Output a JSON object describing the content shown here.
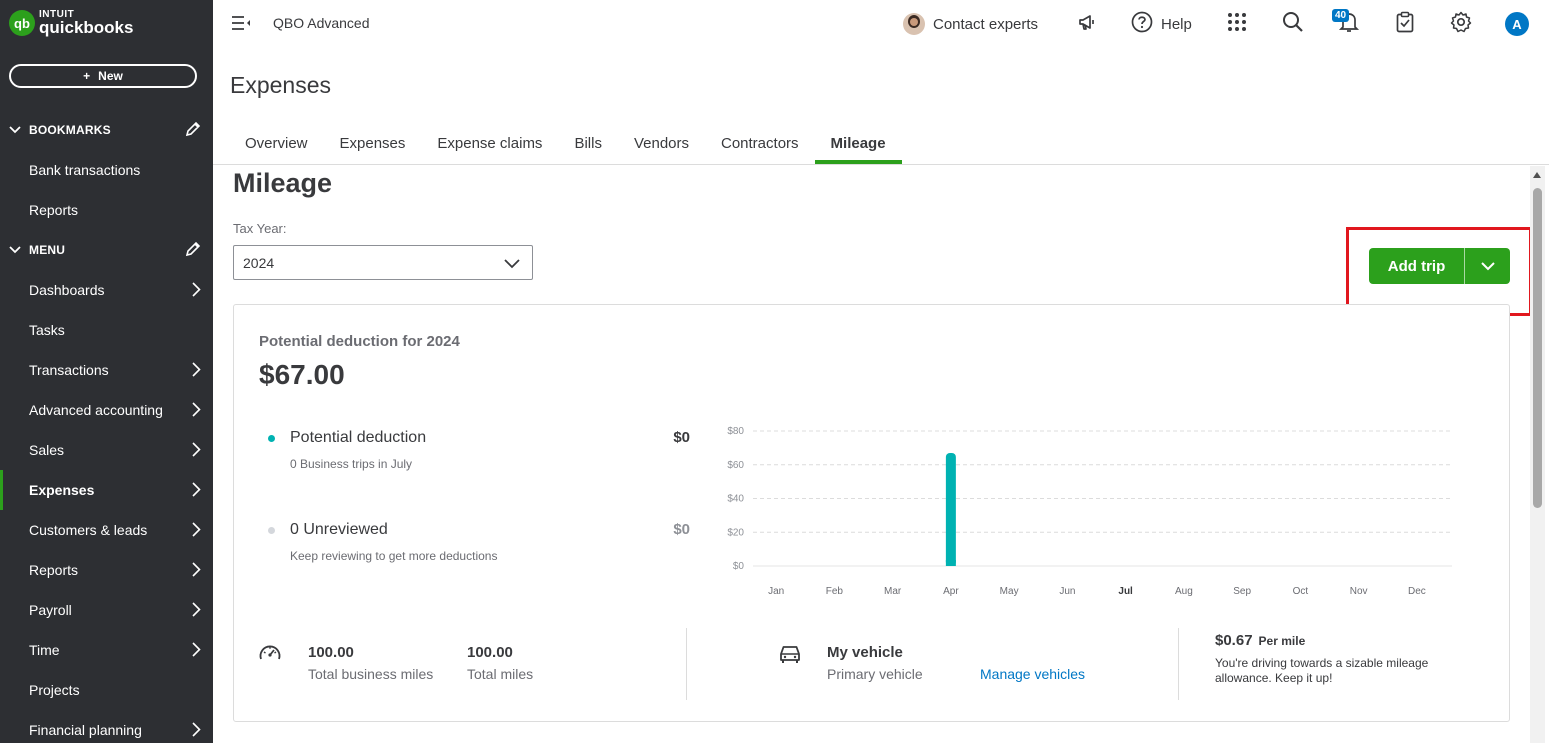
{
  "brand": {
    "logo_mark": "qb",
    "intuit": "INTUIT",
    "name": "quickbooks",
    "accent": "#2ca01c"
  },
  "sidebar": {
    "new_label": "New",
    "bookmarks_title": "BOOKMARKS",
    "bookmarks": [
      {
        "label": "Bank transactions"
      },
      {
        "label": "Reports"
      }
    ],
    "menu_title": "MENU",
    "menu": [
      {
        "label": "Dashboards",
        "has_arrow": true
      },
      {
        "label": "Tasks",
        "has_arrow": false
      },
      {
        "label": "Transactions",
        "has_arrow": true
      },
      {
        "label": "Advanced accounting",
        "has_arrow": true
      },
      {
        "label": "Sales",
        "has_arrow": true
      },
      {
        "label": "Expenses",
        "has_arrow": true,
        "active": true
      },
      {
        "label": "Customers & leads",
        "has_arrow": true
      },
      {
        "label": "Reports",
        "has_arrow": true
      },
      {
        "label": "Payroll",
        "has_arrow": true
      },
      {
        "label": "Time",
        "has_arrow": true
      },
      {
        "label": "Projects",
        "has_arrow": false
      },
      {
        "label": "Financial planning",
        "has_arrow": true
      }
    ]
  },
  "topbar": {
    "app_name": "QBO Advanced",
    "contact_experts": "Contact experts",
    "help": "Help",
    "notifications_count": "40",
    "user_initial": "A"
  },
  "header": {
    "title": "Expenses",
    "tabs": [
      {
        "label": "Overview"
      },
      {
        "label": "Expenses"
      },
      {
        "label": "Expense claims"
      },
      {
        "label": "Bills"
      },
      {
        "label": "Vendors"
      },
      {
        "label": "Contractors"
      },
      {
        "label": "Mileage",
        "active": true
      }
    ]
  },
  "mileage": {
    "title": "Mileage",
    "tax_year_label": "Tax Year:",
    "tax_year_value": "2024",
    "add_trip_label": "Add trip",
    "card": {
      "deduction_label": "Potential deduction for 2024",
      "deduction_amount": "$67.00",
      "legend": [
        {
          "label": "Potential deduction",
          "sub": "0 Business trips in July",
          "value": "$0",
          "dot_color": "#00b2b2"
        },
        {
          "label": "0 Unreviewed",
          "sub": "Keep reviewing to get more deductions",
          "value": "$0",
          "dot_color": "#d4d7dc"
        }
      ],
      "stats": {
        "total_business_miles": "100.00",
        "total_business_miles_label": "Total business miles",
        "total_miles": "100.00",
        "total_miles_label": "Total miles",
        "vehicle_name": "My vehicle",
        "vehicle_sub": "Primary vehicle",
        "manage_vehicles": "Manage vehicles",
        "rate": "$0.67",
        "rate_unit": "Per mile",
        "rate_message": "You're driving towards a sizable mileage allowance. Keep it up!"
      }
    }
  },
  "chart_data": {
    "type": "bar",
    "categories": [
      "Jan",
      "Feb",
      "Mar",
      "Apr",
      "May",
      "Jun",
      "Jul",
      "Aug",
      "Sep",
      "Oct",
      "Nov",
      "Dec"
    ],
    "values": [
      0,
      0,
      0,
      67,
      0,
      0,
      0,
      0,
      0,
      0,
      0,
      0
    ],
    "y_ticks": [
      "$0",
      "$20",
      "$40",
      "$60",
      "$80"
    ],
    "ylim": [
      0,
      80
    ],
    "highlight_category": "Jul",
    "bar_color": "#00b2b2",
    "grid": true
  }
}
